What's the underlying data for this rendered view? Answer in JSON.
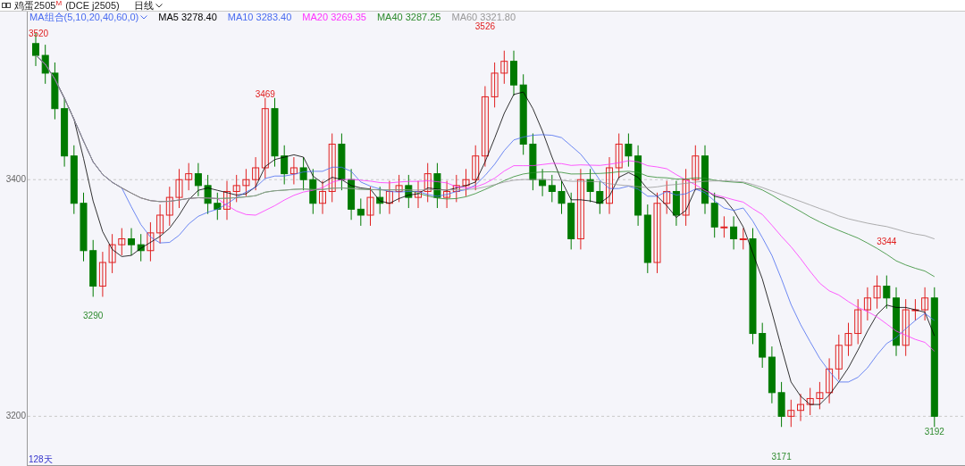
{
  "header": {
    "name": "鸡蛋2505",
    "mark": "M",
    "code": "(DCE j2505)",
    "period": "日线"
  },
  "legend": {
    "group": "MA组合(5,10,20,40,60,0)",
    "items": [
      {
        "label": "MA5",
        "value": "3278.40",
        "color": "#000000"
      },
      {
        "label": "MA10",
        "value": "3283.40",
        "color": "#4a6cf0"
      },
      {
        "label": "MA20",
        "value": "3269.35",
        "color": "#ff33ff"
      },
      {
        "label": "MA40",
        "value": "3287.25",
        "color": "#2e8b2e"
      },
      {
        "label": "MA60",
        "value": "3321.80",
        "color": "#999999"
      }
    ]
  },
  "axis_labels": [
    "3400",
    "3200"
  ],
  "price_labels": [
    {
      "text": "3520",
      "kind": "high"
    },
    {
      "text": "3469",
      "kind": "high"
    },
    {
      "text": "3526",
      "kind": "high"
    },
    {
      "text": "3344",
      "kind": "high"
    },
    {
      "text": "3290",
      "kind": "low"
    },
    {
      "text": "3171",
      "kind": "low"
    },
    {
      "text": "3192",
      "kind": "low"
    }
  ],
  "footer": {
    "days": "128天"
  }
}
